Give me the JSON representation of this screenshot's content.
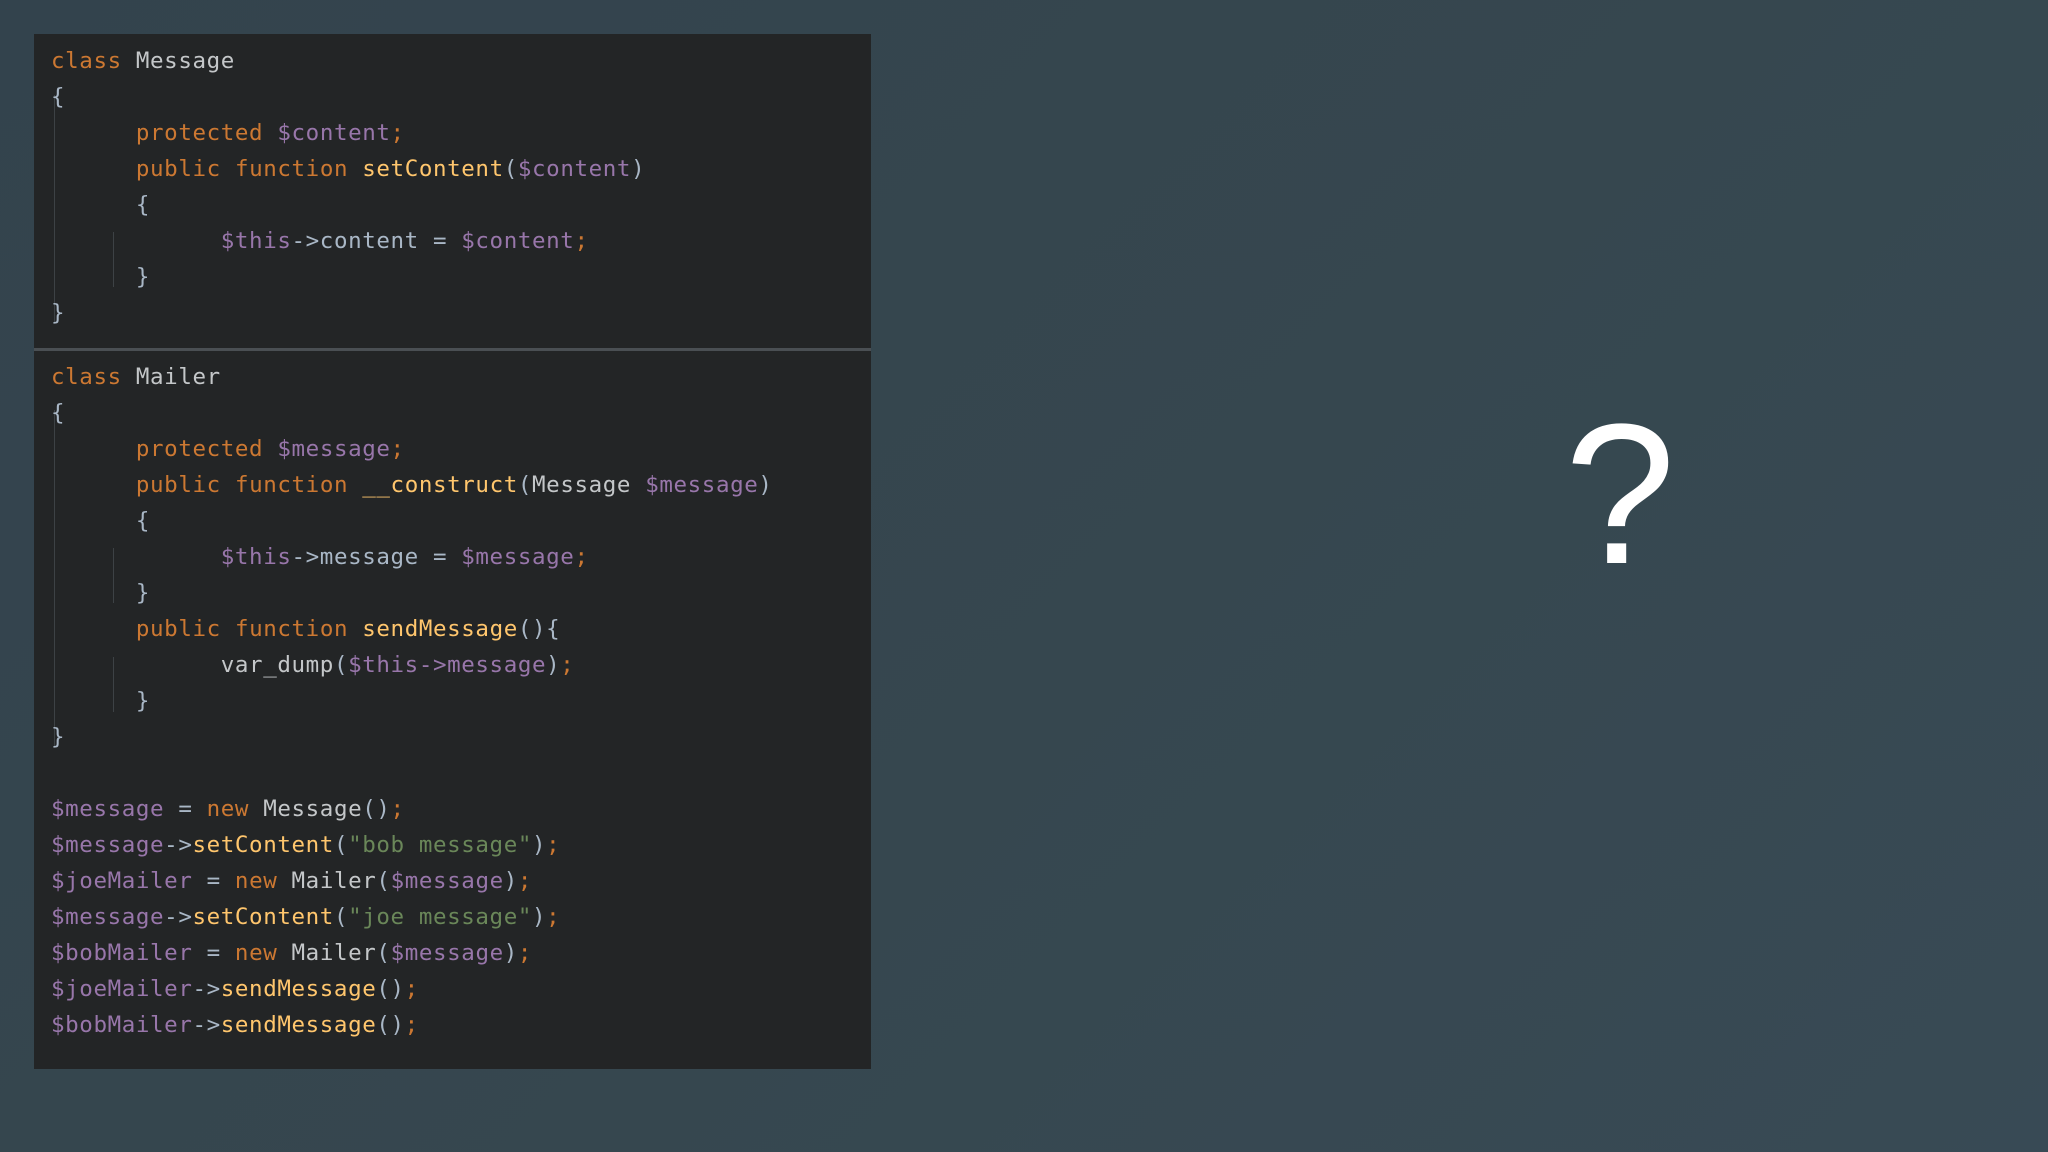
{
  "colors": {
    "background": "#36474f",
    "code_panel": "#232526",
    "keyword": "#cc7832",
    "variable": "#9876aa",
    "function": "#ffc66d",
    "string": "#6a8759",
    "plain": "#a9b7c6"
  },
  "code_block_1": {
    "line_1": {
      "kw": "class",
      "name": "Message"
    },
    "line_2": {
      "brace": "{"
    },
    "line_3": {
      "kw": "protected",
      "var": "$content",
      "semi": ";"
    },
    "line_4": {
      "kw1": "public",
      "kw2": "function",
      "fn": "setContent",
      "open": "(",
      "arg": "$content",
      "close": ")"
    },
    "line_5": {
      "brace": "{"
    },
    "line_6": {
      "var1": "$this",
      "arrow": "->content = ",
      "var2": "$content",
      "semi": ";"
    },
    "line_7": {
      "brace": "}"
    },
    "line_8": {
      "brace": "}"
    }
  },
  "code_block_2": {
    "line_1": {
      "kw": "class",
      "name": "Mailer"
    },
    "line_2": {
      "brace": "{"
    },
    "line_3": {
      "kw": "protected",
      "var": "$message",
      "semi": ";"
    },
    "line_4": {
      "kw1": "public",
      "kw2": "function",
      "fn": "__construct",
      "open": "(",
      "type": "Message",
      "arg": "$message",
      "close": ")"
    },
    "line_5": {
      "brace": "{"
    },
    "line_6": {
      "var1": "$this",
      "arrow": "->message = ",
      "var2": "$message",
      "semi": ";"
    },
    "line_7": {
      "brace": "}"
    },
    "line_8": {
      "kw1": "public",
      "kw2": "function",
      "fn": "sendMessage",
      "rest": "(){"
    },
    "line_9": {
      "fn": "var_dump",
      "open": "(",
      "var": "$this->message",
      "close": ")",
      "semi": ";"
    },
    "line_10": {
      "brace": "}"
    },
    "line_11": {
      "brace": "}"
    },
    "line_12": {
      "var": "$message",
      "eq": " = ",
      "kw": "new",
      "cls": " Message",
      "paren": "()",
      "semi": ";"
    },
    "line_13": {
      "var": "$message",
      "arrow": "->",
      "fn": "setContent",
      "open": "(",
      "str": "\"bob message\"",
      "close": ")",
      "semi": ";"
    },
    "line_14": {
      "var": "$joeMailer",
      "eq": " = ",
      "kw": "new",
      "cls": " Mailer",
      "open": "(",
      "arg": "$message",
      "close": ")",
      "semi": ";"
    },
    "line_15": {
      "var": "$message",
      "arrow": "->",
      "fn": "setContent",
      "open": "(",
      "str": "\"joe message\"",
      "close": ")",
      "semi": ";"
    },
    "line_16": {
      "var": "$bobMailer",
      "eq": " = ",
      "kw": "new",
      "cls": " Mailer",
      "open": "(",
      "arg": "$message",
      "close": ")",
      "semi": ";"
    },
    "line_17": {
      "var": "$joeMailer",
      "arrow": "->",
      "fn": "sendMessage",
      "paren": "()",
      "semi": ";"
    },
    "line_18": {
      "var": "$bobMailer",
      "arrow": "->",
      "fn": "sendMessage",
      "paren": "()",
      "semi": ";"
    }
  },
  "question_mark": "?"
}
